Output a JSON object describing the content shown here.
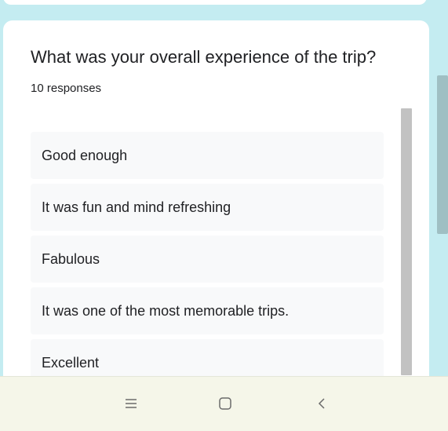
{
  "question": {
    "title": "What was your overall experience of the trip?",
    "response_count": "10 responses"
  },
  "responses": [
    "Good enough",
    "It was fun and mind refreshing",
    "Fabulous",
    "It was one of the most memorable trips.",
    "Excellent"
  ],
  "navbar": {
    "menu_icon": "menu-icon",
    "home_icon": "home-icon",
    "back_icon": "back-icon"
  },
  "colors": {
    "page_background": "#c4ecf1",
    "card_background": "#ffffff",
    "response_background": "#f8f9fa",
    "navbar_background": "#f5f6e9",
    "text": "#202124"
  }
}
